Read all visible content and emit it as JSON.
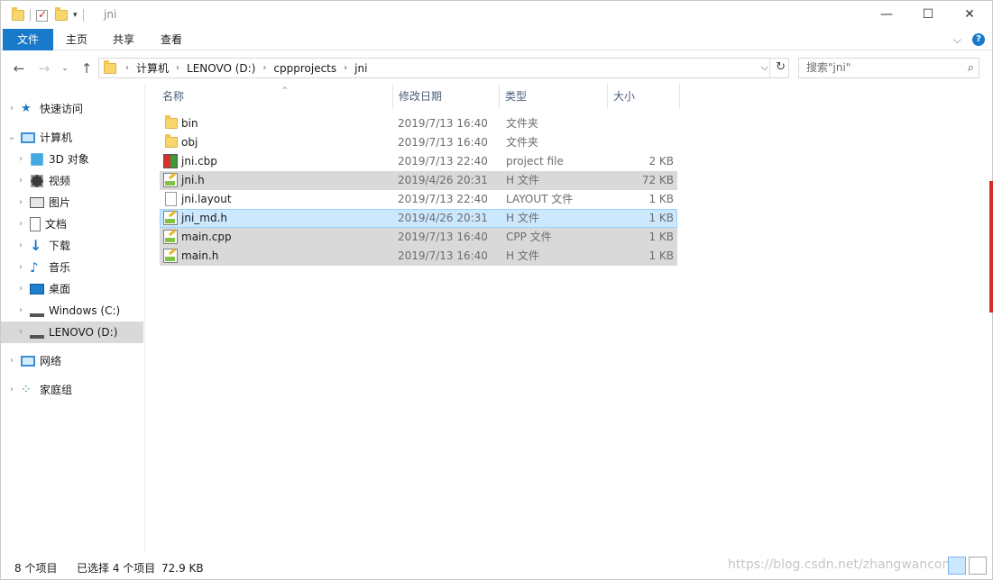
{
  "window": {
    "title": "jni",
    "controls": {
      "minimize": "—",
      "maximize": "☐",
      "close": "✕"
    }
  },
  "ribbon": {
    "tabs": [
      "文件",
      "主页",
      "共享",
      "查看"
    ]
  },
  "address_bar": {
    "breadcrumbs": [
      "计算机",
      "LENOVO (D:)",
      "cppprojects",
      "jni"
    ],
    "search_placeholder": "搜索\"jni\""
  },
  "nav_pane": {
    "items": [
      {
        "label": "快速访问",
        "icon": "star-icon",
        "level": 0
      },
      {
        "label": "计算机",
        "icon": "computer-icon",
        "level": 0
      },
      {
        "label": "3D 对象",
        "icon": "cube-icon",
        "level": 1
      },
      {
        "label": "视频",
        "icon": "video-icon",
        "level": 1
      },
      {
        "label": "图片",
        "icon": "picture-icon",
        "level": 1
      },
      {
        "label": "文档",
        "icon": "document-icon",
        "level": 1
      },
      {
        "label": "下载",
        "icon": "download-icon",
        "level": 1
      },
      {
        "label": "音乐",
        "icon": "music-icon",
        "level": 1
      },
      {
        "label": "桌面",
        "icon": "desktop-icon",
        "level": 1
      },
      {
        "label": "Windows (C:)",
        "icon": "drive-icon",
        "level": 1
      },
      {
        "label": "LENOVO (D:)",
        "icon": "drive-icon",
        "level": 1,
        "selected": true
      },
      {
        "label": "网络",
        "icon": "network-icon",
        "level": 0
      },
      {
        "label": "家庭组",
        "icon": "homegroup-icon",
        "level": 0
      }
    ]
  },
  "file_list": {
    "columns": [
      "名称",
      "修改日期",
      "类型",
      "大小"
    ],
    "rows": [
      {
        "name": "bin",
        "date": "2019/7/13 16:40",
        "type": "文件夹",
        "size": "",
        "icon": "folder-icon",
        "state": ""
      },
      {
        "name": "obj",
        "date": "2019/7/13 16:40",
        "type": "文件夹",
        "size": "",
        "icon": "folder-icon",
        "state": ""
      },
      {
        "name": "jni.cbp",
        "date": "2019/7/13 22:40",
        "type": "project file",
        "size": "2 KB",
        "icon": "codeblocks-project-icon",
        "state": ""
      },
      {
        "name": "jni.h",
        "date": "2019/4/26 20:31",
        "type": "H 文件",
        "size": "72 KB",
        "icon": "header-file-icon",
        "state": "selected"
      },
      {
        "name": "jni.layout",
        "date": "2019/7/13 22:40",
        "type": "LAYOUT 文件",
        "size": "1 KB",
        "icon": "blank-file-icon",
        "state": ""
      },
      {
        "name": "jni_md.h",
        "date": "2019/4/26 20:31",
        "type": "H 文件",
        "size": "1 KB",
        "icon": "header-file-icon",
        "state": "focused"
      },
      {
        "name": "main.cpp",
        "date": "2019/7/13 16:40",
        "type": "CPP 文件",
        "size": "1 KB",
        "icon": "header-file-icon",
        "state": "selected"
      },
      {
        "name": "main.h",
        "date": "2019/7/13 16:40",
        "type": "H 文件",
        "size": "1 KB",
        "icon": "header-file-icon",
        "state": "selected"
      }
    ]
  },
  "status_bar": {
    "item_count": "8 个项目",
    "selection": "已选择 4 个项目",
    "selection_size": "72.9 KB",
    "watermark": "https://blog.csdn.net/zhangwancon"
  }
}
